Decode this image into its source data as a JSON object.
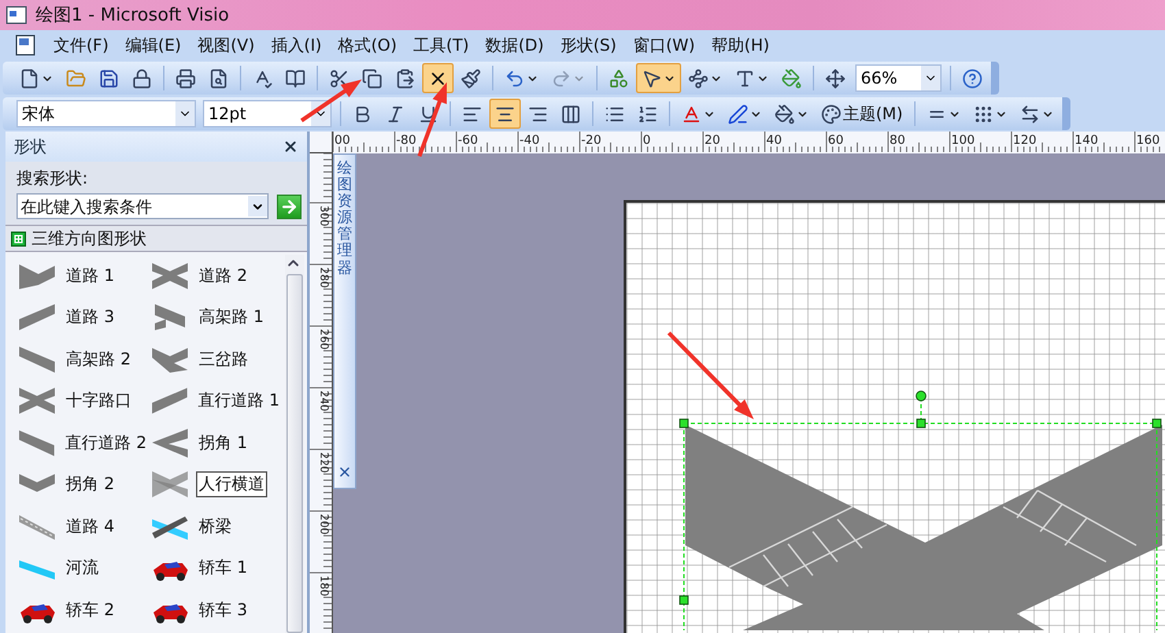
{
  "window": {
    "title": "绘图1 - Microsoft Visio"
  },
  "menu": [
    "文件(F)",
    "编辑(E)",
    "视图(V)",
    "插入(I)",
    "格式(O)",
    "工具(T)",
    "数据(D)",
    "形状(S)",
    "窗口(W)",
    "帮助(H)"
  ],
  "standard_toolbar": {
    "groups": [
      [
        {
          "kind": "new",
          "dropdown": true,
          "active": false,
          "disabled": false
        },
        {
          "kind": "open",
          "dropdown": false,
          "active": false,
          "disabled": false
        },
        {
          "kind": "save",
          "dropdown": false,
          "active": false,
          "disabled": false
        },
        {
          "kind": "permission",
          "dropdown": false,
          "active": false,
          "disabled": false
        }
      ],
      [
        {
          "kind": "print",
          "dropdown": false,
          "active": false,
          "disabled": false
        },
        {
          "kind": "preview",
          "dropdown": false,
          "active": false,
          "disabled": false
        }
      ],
      [
        {
          "kind": "spelling",
          "dropdown": false,
          "active": false,
          "disabled": false
        },
        {
          "kind": "research",
          "dropdown": false,
          "active": false,
          "disabled": false
        }
      ],
      [
        {
          "kind": "cut",
          "dropdown": false,
          "active": false,
          "disabled": false
        },
        {
          "kind": "copy",
          "dropdown": false,
          "active": false,
          "disabled": false
        },
        {
          "kind": "paste",
          "dropdown": false,
          "active": false,
          "disabled": false
        },
        {
          "kind": "delete",
          "dropdown": false,
          "active": true,
          "disabled": false
        },
        {
          "kind": "painter",
          "dropdown": false,
          "active": false,
          "disabled": false
        }
      ],
      [
        {
          "kind": "undo",
          "dropdown": true,
          "active": false,
          "disabled": false
        },
        {
          "kind": "redo",
          "dropdown": true,
          "active": false,
          "disabled": true
        }
      ],
      [
        {
          "kind": "shapes",
          "dropdown": false,
          "active": false,
          "disabled": false
        },
        {
          "kind": "pointer",
          "dropdown": true,
          "active": true,
          "disabled": false
        },
        {
          "kind": "connector",
          "dropdown": true,
          "active": false,
          "disabled": false
        },
        {
          "kind": "text",
          "dropdown": true,
          "active": false,
          "disabled": false
        },
        {
          "kind": "fill",
          "dropdown": false,
          "active": false,
          "disabled": false
        }
      ],
      [
        {
          "kind": "pan",
          "dropdown": false,
          "active": false,
          "disabled": false
        },
        {
          "kind": "zoom",
          "value": "66%",
          "dropdown": true
        }
      ],
      [
        {
          "kind": "help",
          "dropdown": false,
          "active": false,
          "disabled": false
        }
      ]
    ]
  },
  "format_toolbar": {
    "groups": [
      [
        {
          "kind": "font",
          "value": "宋体",
          "dropdown": true
        },
        {
          "kind": "size",
          "value": "12pt",
          "dropdown": true
        }
      ],
      [
        {
          "kind": "bold",
          "dropdown": false,
          "active": false,
          "disabled": false
        },
        {
          "kind": "italic",
          "dropdown": false,
          "active": false,
          "disabled": false
        },
        {
          "kind": "underline",
          "dropdown": false,
          "active": false,
          "disabled": false
        }
      ],
      [
        {
          "kind": "align-left",
          "dropdown": false,
          "active": false,
          "disabled": false
        },
        {
          "kind": "align-center",
          "dropdown": false,
          "active": true,
          "disabled": false
        },
        {
          "kind": "align-right",
          "dropdown": false,
          "active": false,
          "disabled": false
        },
        {
          "kind": "distribute",
          "dropdown": false,
          "active": false,
          "disabled": false
        }
      ],
      [
        {
          "kind": "bullets",
          "dropdown": false,
          "active": false,
          "disabled": false
        },
        {
          "kind": "indent",
          "dropdown": false,
          "active": false,
          "disabled": false
        }
      ],
      [
        {
          "kind": "font-color",
          "dropdown": true,
          "active": false,
          "disabled": false
        },
        {
          "kind": "line-color",
          "dropdown": true,
          "active": false,
          "disabled": false
        },
        {
          "kind": "fill-color",
          "dropdown": true,
          "active": false,
          "disabled": false
        },
        {
          "kind": "theme",
          "label": "主题(M)",
          "dropdown": false,
          "active": false,
          "disabled": false
        }
      ],
      [
        {
          "kind": "line-weight",
          "dropdown": true,
          "active": false,
          "disabled": false
        },
        {
          "kind": "line-pattern",
          "dropdown": true,
          "active": false,
          "disabled": false
        },
        {
          "kind": "line-ends",
          "dropdown": true,
          "active": false,
          "disabled": false
        }
      ]
    ]
  },
  "shapes_panel": {
    "title": "形状",
    "search_label": "搜索形状:",
    "search": {
      "placeholder": "在此键入搜索条件"
    },
    "stencil": "三维方向图形状",
    "shapes": [
      {
        "label": "道路 1",
        "kind": "y-road",
        "selected": false
      },
      {
        "label": "道路 2",
        "kind": "x-road",
        "selected": false
      },
      {
        "label": "道路 3",
        "kind": "slant-up",
        "selected": false
      },
      {
        "label": "高架路 1",
        "kind": "overpass",
        "selected": false
      },
      {
        "label": "高架路 2",
        "kind": "slant-down",
        "selected": false
      },
      {
        "label": "三岔路",
        "kind": "fork",
        "selected": false
      },
      {
        "label": "十字路口",
        "kind": "x-road",
        "selected": false
      },
      {
        "label": "直行道路 1",
        "kind": "slant-up",
        "selected": false
      },
      {
        "label": "直行道路 2",
        "kind": "slant-down",
        "selected": false
      },
      {
        "label": "拐角 1",
        "kind": "chevron",
        "selected": false
      },
      {
        "label": "拐角 2",
        "kind": "v-road",
        "selected": false
      },
      {
        "label": "人行横道",
        "kind": "crosswalk",
        "selected": true
      },
      {
        "label": "道路 4",
        "kind": "dotted-road",
        "selected": false
      },
      {
        "label": "桥梁",
        "kind": "bridge",
        "selected": false
      },
      {
        "label": "河流",
        "kind": "river",
        "selected": false
      },
      {
        "label": "轿车 1",
        "kind": "car",
        "selected": false
      },
      {
        "label": "轿车 2",
        "kind": "car",
        "selected": false
      },
      {
        "label": "轿车 3",
        "kind": "car",
        "selected": false
      }
    ]
  },
  "top_ruler": [
    "00",
    "-80",
    "-60",
    "-40",
    "-20",
    "0",
    "20",
    "40",
    "60",
    "80",
    "100",
    "120",
    "140",
    "160"
  ],
  "side_ruler": [
    "300",
    "280",
    "260",
    "240",
    "220",
    "200",
    "180"
  ],
  "drawing_explorer": {
    "title": "绘图资源管理器"
  }
}
